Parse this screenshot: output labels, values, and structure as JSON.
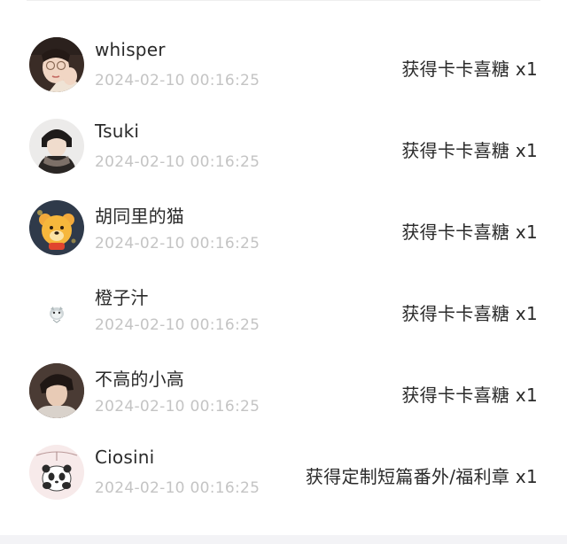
{
  "records": [
    {
      "name": "whisper",
      "time": "2024-02-10 00:16:25",
      "reward": "获得卡卡喜糖 x1",
      "avatar_icon": "woman-portrait-avatar"
    },
    {
      "name": "Tsuki",
      "time": "2024-02-10 00:16:25",
      "reward": "获得卡卡喜糖 x1",
      "avatar_icon": "man-scarf-portrait-avatar"
    },
    {
      "name": "胡同里的猫",
      "time": "2024-02-10 00:16:25",
      "reward": "获得卡卡喜糖 x1",
      "avatar_icon": "cartoon-bear-avatar"
    },
    {
      "name": "橙子汁",
      "time": "2024-02-10 00:16:25",
      "reward": "获得卡卡喜糖 x1",
      "avatar_icon": "small-animal-avatar"
    },
    {
      "name": "不高的小高",
      "time": "2024-02-10 00:16:25",
      "reward": "获得卡卡喜糖 x1",
      "avatar_icon": "man-portrait-avatar"
    },
    {
      "name": "Ciosini",
      "time": "2024-02-10 00:16:25",
      "reward": "获得定制短篇番外/福利章 x1",
      "avatar_icon": "panda-sticker-avatar"
    }
  ],
  "colors": {
    "name_text": "#2a2a2a",
    "time_text": "#c4c4c4",
    "reward_text": "#2a2a2a",
    "background": "#ffffff"
  }
}
